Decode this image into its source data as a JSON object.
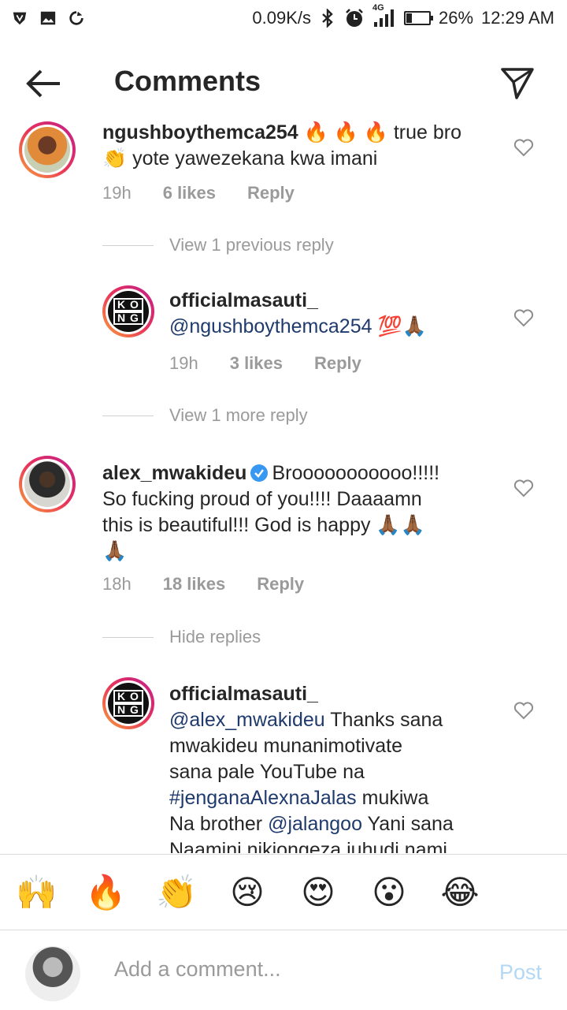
{
  "status": {
    "speed": "0.09K/s",
    "network": "4G",
    "battery": "26%",
    "time": "12:29 AM",
    "battery_level": 0.26
  },
  "header": {
    "title": "Comments"
  },
  "comments": [
    {
      "user": "ngushboythemca254",
      "text_1": "🔥 🔥 🔥 true bro",
      "text_2": "👏 yote yawezekana kwa imani",
      "time": "19h",
      "likes": "6 likes",
      "reply": "Reply"
    },
    {
      "view_more": "View 1 previous reply"
    },
    {
      "user": "officialmasauti_",
      "mention": "@ngushboythemca254",
      "text": " 💯🙏🏾",
      "time": "19h",
      "likes": "3 likes",
      "reply": "Reply"
    },
    {
      "view_more": "View 1 more reply"
    },
    {
      "user": "alex_mwakideu",
      "text_1": "Brooooooooooo!!!!!",
      "text_2": "So fucking proud of you!!!! Daaaamn",
      "text_3": "this is beautiful!!! God is happy 🙏🏾🙏🏾",
      "text_4": "🙏🏾",
      "time": "18h",
      "likes": "18 likes",
      "reply": "Reply"
    },
    {
      "view_more": "Hide replies"
    },
    {
      "user": "officialmasauti_",
      "mention": "@alex_mwakideu",
      "text_1": " Thanks sana",
      "text_2": "mwakideu munanimotivate",
      "text_3": "sana pale YouTube na",
      "hashtag": "#jenganaAlexnaJalas",
      "text_4": " mukiwa",
      "text_5a": "Na brother ",
      "mention_2": "@jalangoo",
      "text_5b": " Yani sana",
      "text_6": "Naamini nikiongeza juhudi nami"
    }
  ],
  "emoji_bar": [
    "🙌",
    "🔥",
    "👏",
    "😢",
    "😍",
    "😮",
    "😂"
  ],
  "composer": {
    "placeholder": "Add a comment...",
    "post_label": "Post"
  }
}
